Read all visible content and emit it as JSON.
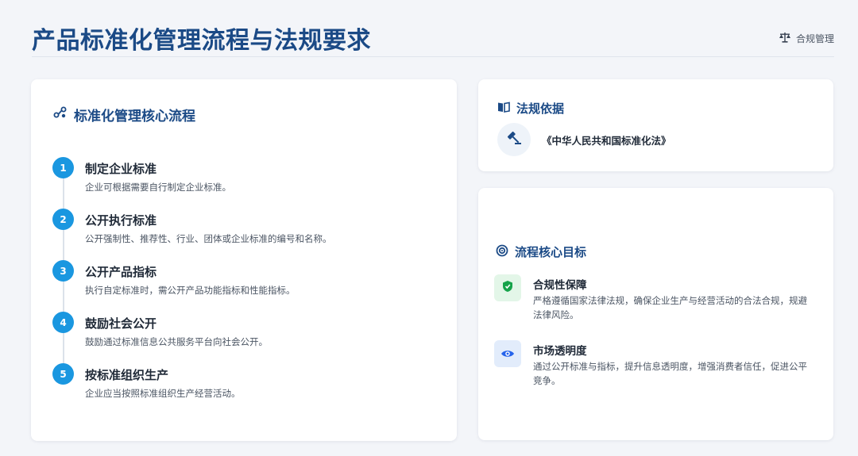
{
  "header": {
    "title": "产品标准化管理流程与法规要求",
    "tag_label": "合规管理",
    "tag_icon": "scale-icon"
  },
  "process": {
    "heading": "标准化管理核心流程",
    "heading_icon": "flow-nodes-icon",
    "steps": [
      {
        "num": "1",
        "title": "制定企业标准",
        "desc": "企业可根据需要自行制定企业标准。"
      },
      {
        "num": "2",
        "title": "公开执行标准",
        "desc": "公开强制性、推荐性、行业、团体或企业标准的编号和名称。"
      },
      {
        "num": "3",
        "title": "公开产品指标",
        "desc": "执行自定标准时，需公开产品功能指标和性能指标。"
      },
      {
        "num": "4",
        "title": "鼓励社会公开",
        "desc": "鼓励通过标准信息公共服务平台向社会公开。"
      },
      {
        "num": "5",
        "title": "按标准组织生产",
        "desc": "企业应当按照标准组织生产经营活动。"
      }
    ],
    "accent": "#1a97e0"
  },
  "law": {
    "heading": "法规依据",
    "heading_icon": "book-icon",
    "item_icon": "gavel-icon",
    "item_text": "《中华人民共和国标准化法》"
  },
  "goals": {
    "heading": "流程核心目标",
    "heading_icon": "target-icon",
    "items": [
      {
        "icon": "shield-icon",
        "title": "合规性保障",
        "desc": "严格遵循国家法律法规，确保企业生产与经营活动的合法合规，规避法律风险。",
        "color": "#16a34a",
        "bg": "#e3f6e8"
      },
      {
        "icon": "eye-icon",
        "title": "市场透明度",
        "desc": "通过公开标准与指标，提升信息透明度，增强消费者信任，促进公平竞争。",
        "color": "#2563eb",
        "bg": "#e2ecfb"
      }
    ]
  },
  "colors": {
    "title": "#1b4a86",
    "background": "#f3f5f9"
  }
}
